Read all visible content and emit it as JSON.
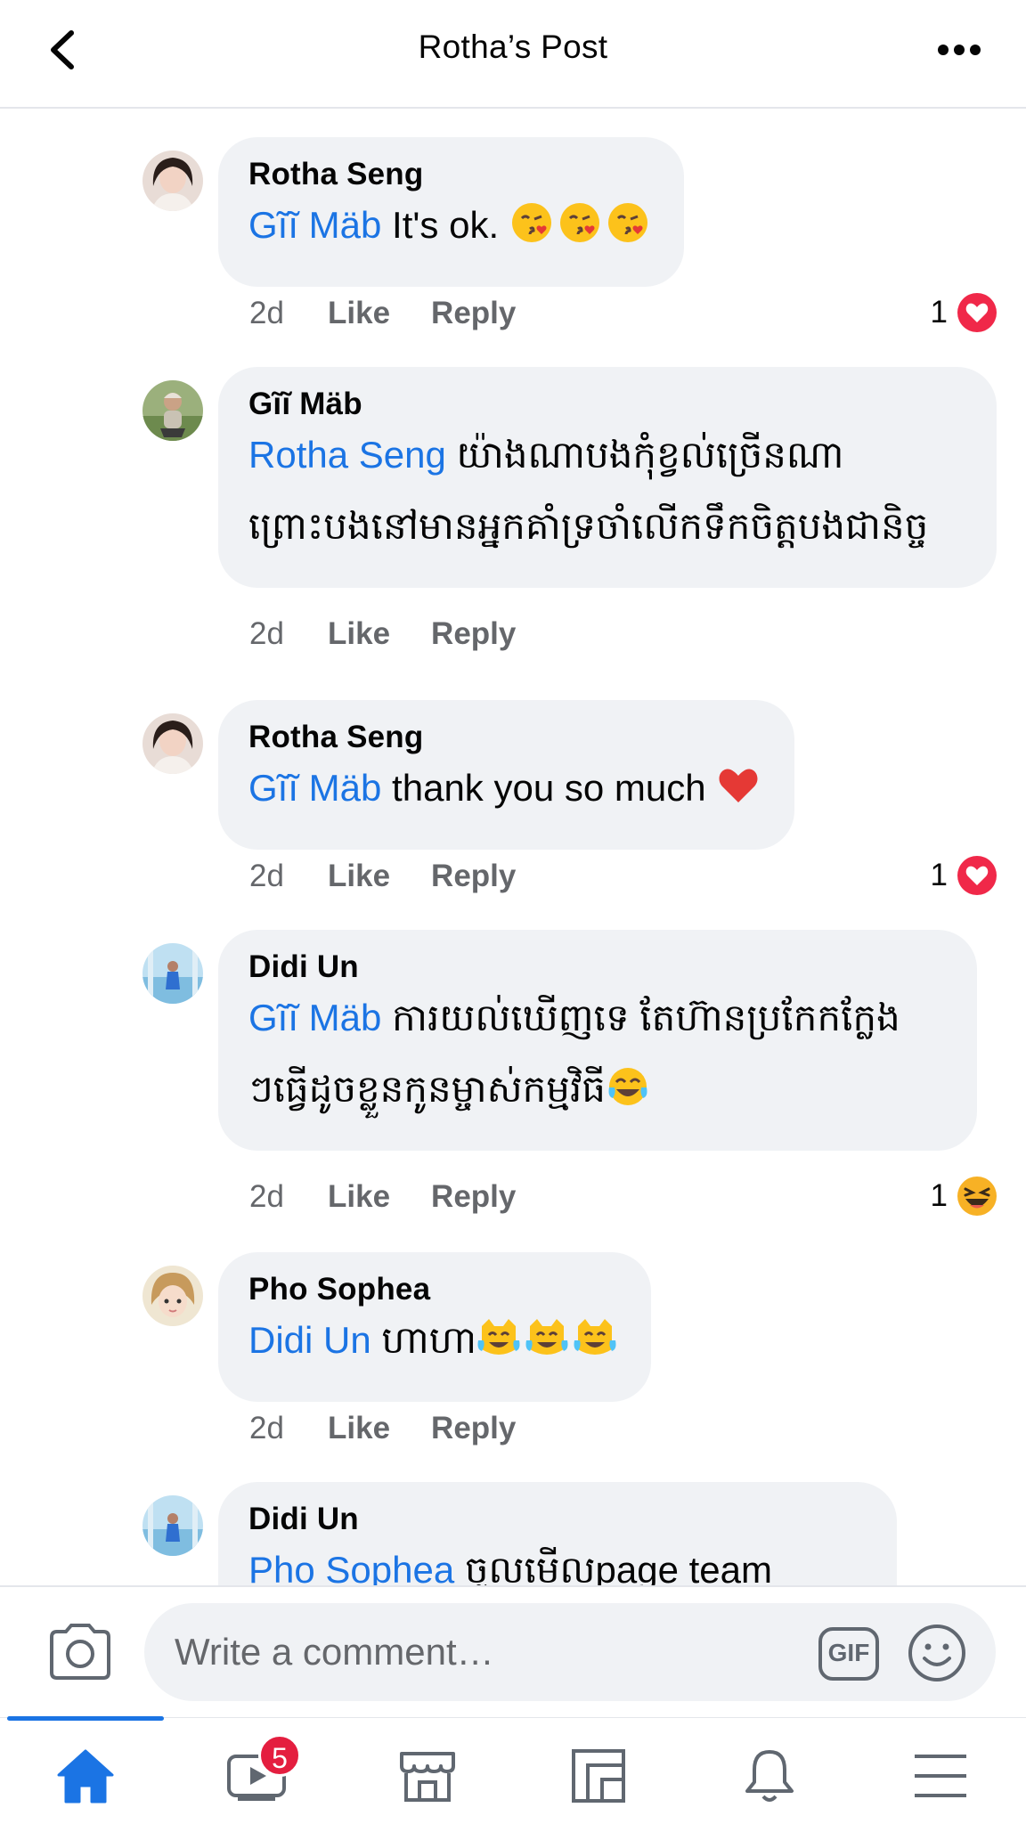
{
  "header": {
    "title": "Rotha’s Post",
    "back_icon": "chevron-left-icon",
    "more_icon": "more-horizontal-icon"
  },
  "colors": {
    "accent": "#1b74e4",
    "bubble": "#f0f2f5",
    "muted": "#65676b",
    "heart": "#f02849",
    "badge": "#e41e3f"
  },
  "comments": [
    {
      "author": "Rotha Seng",
      "mention": "Gĩĩ Mäb",
      "text": " It's ok. ",
      "emojis": [
        "kiss-heart",
        "kiss-heart",
        "kiss-heart"
      ],
      "time": "2d",
      "like": "Like",
      "reply": "Reply",
      "reaction": {
        "count": "1",
        "icon": "heart-reaction-icon"
      }
    },
    {
      "author": "Gĩĩ Mäb",
      "mention": "Rotha Seng",
      "text": " យ៉ាងណាបងកុំខ្វល់ច្រើនណា",
      "text2": "ព្រោះបងនៅមានអ្នកគាំទ្រចាំលើកទឹកចិត្តបងជានិច្ច",
      "time": "2d",
      "like": "Like",
      "reply": "Reply"
    },
    {
      "author": "Rotha Seng",
      "mention": "Gĩĩ Mäb",
      "text": " thank you so much ",
      "emojis": [
        "red-heart"
      ],
      "time": "2d",
      "like": "Like",
      "reply": "Reply",
      "reaction": {
        "count": "1",
        "icon": "heart-reaction-icon"
      }
    },
    {
      "author": "Didi Un",
      "mention": "Gĩĩ Mäb",
      "text": " ការយល់ឃើញទេ តែហ៊ានប្រកែកក្លែង",
      "text2": "ៗធ្វើដូចខ្លួនកូនម្ចាស់កម្មវិធី",
      "emojis2": [
        "tears-of-joy"
      ],
      "time": "2d",
      "like": "Like",
      "reply": "Reply",
      "reaction": {
        "count": "1",
        "icon": "haha-reaction-icon"
      }
    },
    {
      "author": "Pho Sophea",
      "mention": "Didi Un",
      "text": " ហាហា",
      "emojis": [
        "cat-tears-of-joy",
        "cat-tears-of-joy",
        "cat-tears-of-joy"
      ],
      "time": "2d",
      "like": "Like",
      "reply": "Reply"
    },
    {
      "author": "Didi Un",
      "mention": "Pho Sophea",
      "text": " ចូលមើលpage team"
    }
  ],
  "composer": {
    "placeholder": "Write a comment…",
    "gif_label": "GIF"
  },
  "nav": {
    "watch_badge": "5"
  }
}
